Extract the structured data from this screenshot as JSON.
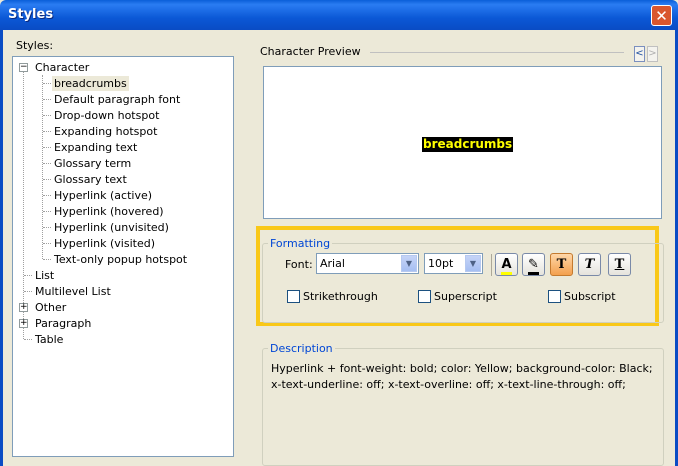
{
  "window": {
    "title": "Styles",
    "close": "✕"
  },
  "styles_label": "Styles:",
  "tree": {
    "character": "Character",
    "character_items": [
      "breadcrumbs",
      "Default paragraph font",
      "Drop-down hotspot",
      "Expanding hotspot",
      "Expanding text",
      "Glossary term",
      "Glossary text",
      "Hyperlink (active)",
      "Hyperlink (hovered)",
      "Hyperlink (unvisited)",
      "Hyperlink (visited)",
      "Text-only popup hotspot"
    ],
    "list": "List",
    "multilevel": "Multilevel List",
    "other": "Other",
    "paragraph": "Paragraph",
    "table": "Table",
    "expanded_sign": "−",
    "collapsed_sign": "+"
  },
  "preview": {
    "label": "Character Preview",
    "sample": "breadcrumbs",
    "prev": "<",
    "next": ">"
  },
  "formatting": {
    "label": "Formatting",
    "font_label": "Font:",
    "font_value": "Arial",
    "size_value": "10pt",
    "buttons": {
      "font_color": "A",
      "highlight": "✎",
      "bold": "T",
      "italic": "T",
      "underline": "T"
    },
    "strikethrough": "Strikethrough",
    "superscript": "Superscript",
    "subscript": "Subscript"
  },
  "description": {
    "label": "Description",
    "line1": "Hyperlink +  font-weight: bold;  color: Yellow;  background-color: Black;",
    "line2": "x-text-underline: off;  x-text-overline: off;  x-text-line-through: off;"
  },
  "colors": {
    "preview_text": "#ffff00",
    "preview_bg": "#000000",
    "highlight": "#f9c818",
    "group_label": "#0046d5"
  }
}
